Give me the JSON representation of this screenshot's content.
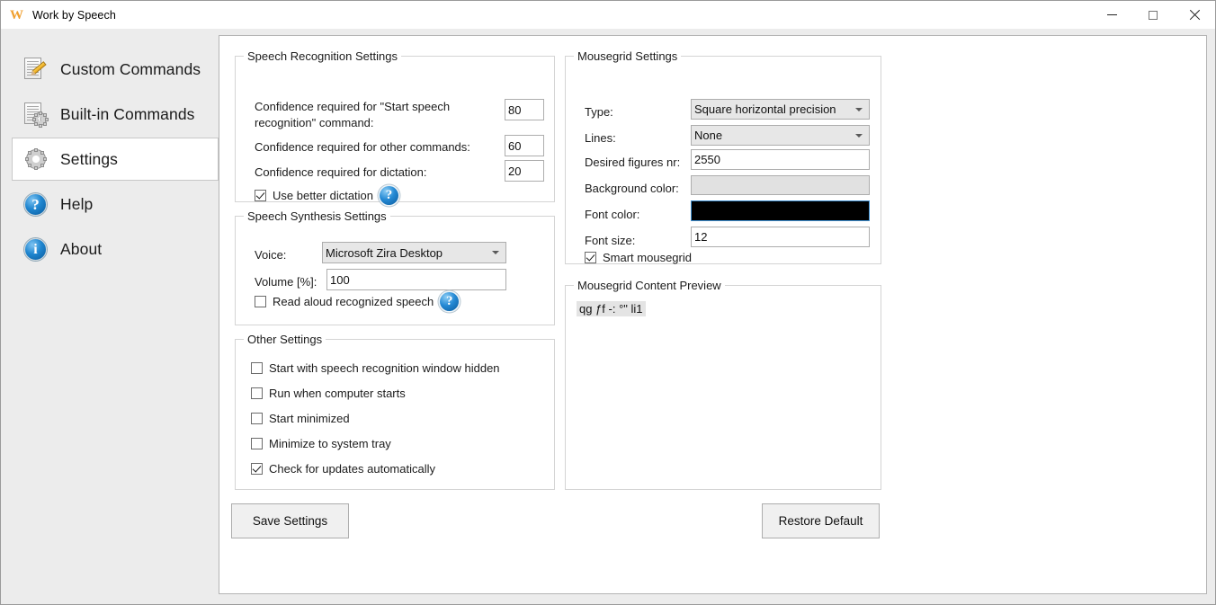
{
  "window": {
    "title": "Work by Speech",
    "logo_icon": "w-logo-icon",
    "controls": {
      "minimize": "minimize-icon",
      "maximize": "maximize-icon",
      "close": "close-icon"
    }
  },
  "sidebar": {
    "items": [
      {
        "label": "Custom Commands",
        "icon": "document-pencil-icon",
        "selected": false
      },
      {
        "label": "Built-in Commands",
        "icon": "document-gear-icon",
        "selected": false
      },
      {
        "label": "Settings",
        "icon": "gear-icon",
        "selected": true
      },
      {
        "label": "Help",
        "icon": "question-circle-icon",
        "selected": false
      },
      {
        "label": "About",
        "icon": "info-circle-icon",
        "selected": false
      }
    ]
  },
  "speech_recognition": {
    "title": "Speech Recognition Settings",
    "confidence_start_label": "Confidence required for \"Start speech recognition\" command:",
    "confidence_start_value": "80",
    "confidence_other_label": "Confidence required for other commands:",
    "confidence_other_value": "60",
    "confidence_dictation_label": "Confidence required for dictation:",
    "confidence_dictation_value": "20",
    "better_dictation_label": "Use better dictation",
    "better_dictation_checked": true,
    "help_glyph": "?"
  },
  "speech_synthesis": {
    "title": "Speech Synthesis Settings",
    "voice_label": "Voice:",
    "voice_value": "Microsoft Zira Desktop",
    "volume_label": "Volume [%]:",
    "volume_value": "100",
    "read_aloud_label": "Read aloud recognized speech",
    "read_aloud_checked": false,
    "help_glyph": "?"
  },
  "other_settings": {
    "title": "Other Settings",
    "items": [
      {
        "label": "Start with speech recognition window hidden",
        "checked": false
      },
      {
        "label": "Run when computer starts",
        "checked": false
      },
      {
        "label": "Start minimized",
        "checked": false
      },
      {
        "label": "Minimize to system tray",
        "checked": false
      },
      {
        "label": "Check for updates automatically",
        "checked": true
      }
    ]
  },
  "mousegrid": {
    "title": "Mousegrid Settings",
    "type_label": "Type:",
    "type_value": "Square horizontal precision",
    "lines_label": "Lines:",
    "lines_value": "None",
    "figures_label": "Desired figures nr:",
    "figures_value": "2550",
    "background_color_label": "Background color:",
    "background_color_value": "#e1e1e1",
    "font_color_label": "Font color:",
    "font_color_value": "#000000",
    "font_size_label": "Font size:",
    "font_size_value": "12",
    "smart_label": "Smart mousegrid",
    "smart_checked": true
  },
  "preview": {
    "title": "Mousegrid Content Preview",
    "sample_text": "qg ƒf -: °\" li1"
  },
  "buttons": {
    "save": "Save Settings",
    "restore": "Restore Default"
  }
}
